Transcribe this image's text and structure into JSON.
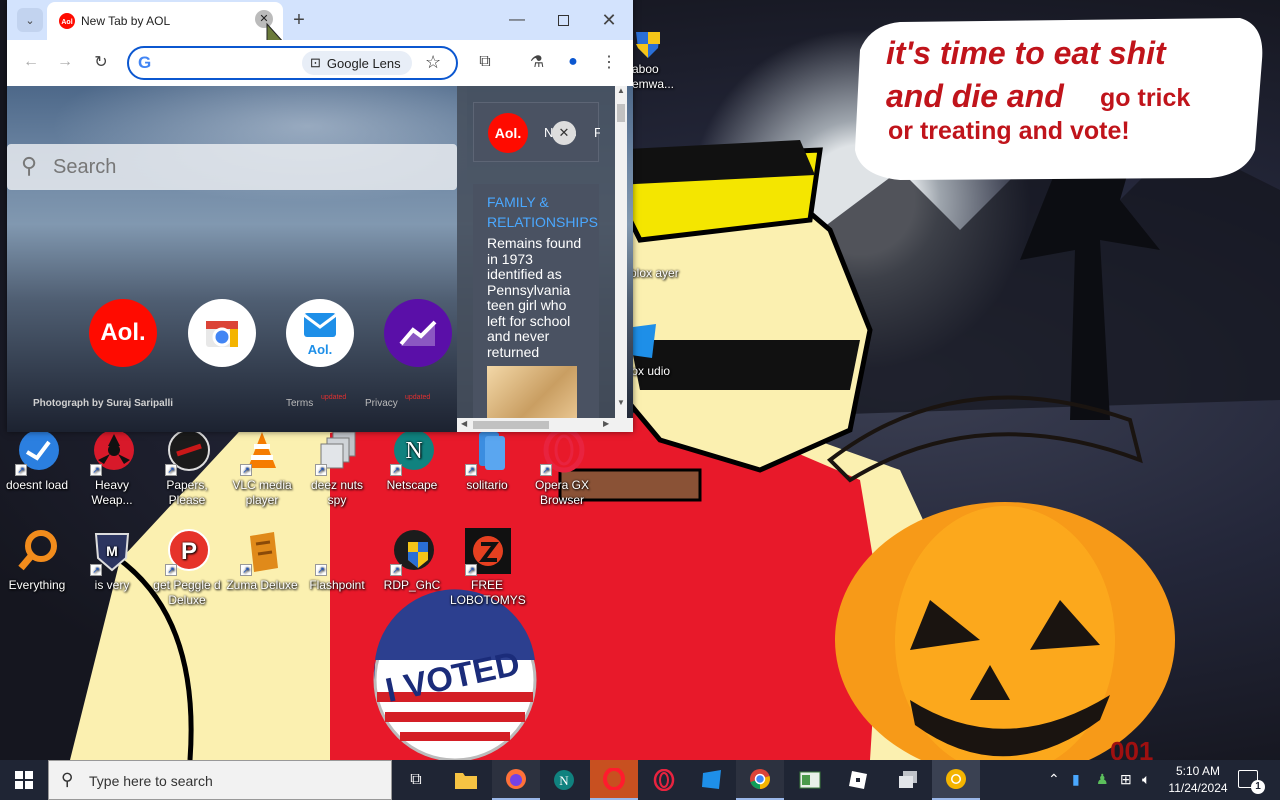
{
  "browser": {
    "tab_title": "New Tab by AOL",
    "lens_label": "Google Lens",
    "search_placeholder": "Search",
    "photo_credit": "Photograph by Suraj Saripalli",
    "footer_links": [
      "Terms",
      "Privacy"
    ],
    "footer_tags": [
      "updated",
      "updated"
    ],
    "shortcuts": [
      "aol",
      "google-shortcuts",
      "aol-mail",
      "finance"
    ],
    "aol_logo": "Aol.",
    "mail_label": "Aol.",
    "panel_nav": [
      "News",
      "Fina"
    ],
    "article": {
      "category": "FAMILY & RELATIONSHIPS",
      "headline": "Remains found in 1973 identified as Pennsylvania teen girl who left for school and never returned"
    }
  },
  "meme": {
    "line1": "it's time to eat shit",
    "line2": "and die and",
    "line2b": "go trick",
    "line3": "or treating and vote!",
    "badge": "I VOTED",
    "signature": "001"
  },
  "desktop": {
    "icons_row1": [
      "doesnt load",
      "Heavy Weap...",
      "Papers, Please",
      "VLC media player",
      "deez nuts spy",
      "Netscape",
      "solitario",
      "Opera GX Browser"
    ],
    "icons_row2": [
      "Everything",
      "is very",
      "get Peggle d Deluxe",
      "Zuma Deluxe",
      "Flashpoint",
      "RDP_GhC",
      "FREE LOBOTOMYS"
    ],
    "icons_right": [
      "aboo emwa...",
      "blox ayer",
      "blox udio"
    ]
  },
  "taskbar": {
    "search_placeholder": "Type here to search",
    "time": "5:10 AM",
    "date": "11/24/2024",
    "notification_count": "1"
  },
  "colors": {
    "accent": "#0b57d0",
    "aol_red": "#ff0b00",
    "finance_purple": "#5a0fa8",
    "meme_text": "#c0141b",
    "taskbar": "#1f2534"
  }
}
